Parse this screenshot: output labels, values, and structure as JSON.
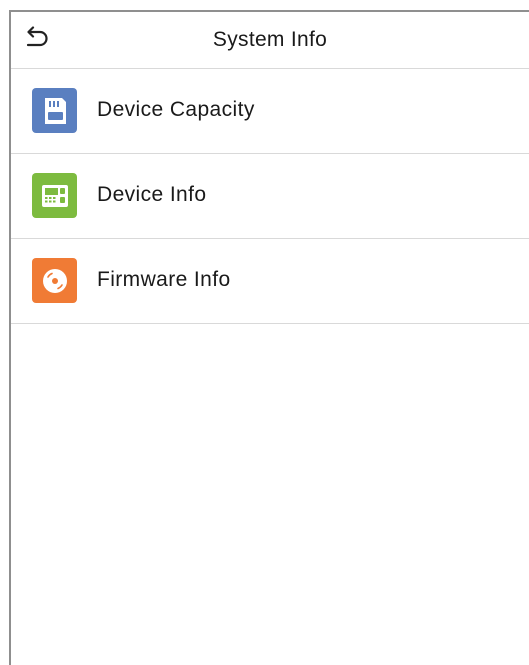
{
  "header": {
    "title": "System Info"
  },
  "menu": {
    "items": [
      {
        "label": "Device Capacity",
        "icon": "sd-card-icon",
        "color": "#5a7fc0"
      },
      {
        "label": "Device Info",
        "icon": "terminal-device-icon",
        "color": "#7dbb3f"
      },
      {
        "label": "Firmware Info",
        "icon": "disc-icon",
        "color": "#f07b35"
      }
    ]
  }
}
